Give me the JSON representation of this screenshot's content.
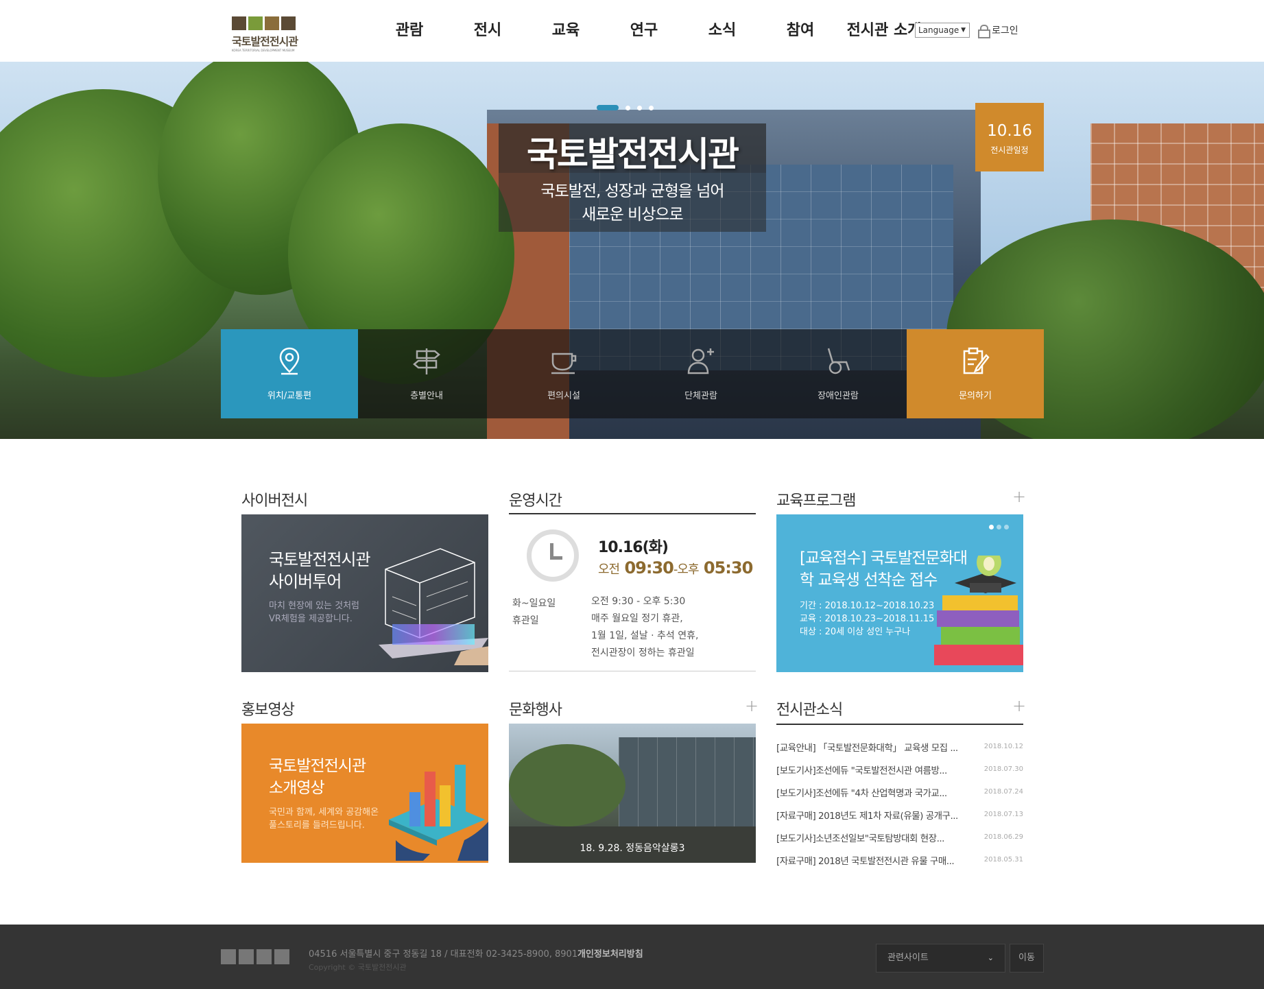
{
  "header": {
    "logo_text": "국토발전전시관",
    "logo_sub": "KOREA TERRITORIAL DEVELOPMENT MUSEUM",
    "nav": [
      "관람",
      "전시",
      "교육",
      "연구",
      "소식",
      "참여",
      "전시관 소개"
    ],
    "language_label": "Language",
    "login_label": "로그인"
  },
  "hero": {
    "title": "국토발전전시관",
    "subtitle_line1": "국토발전, 성장과 균형을 넘어",
    "subtitle_line2": "새로운 비상으로",
    "schedule_date": "10.16",
    "schedule_label": "전시관일정",
    "quick_links": [
      "위치/교통편",
      "층별안내",
      "편의시설",
      "단체관람",
      "장애인관람",
      "문의하기"
    ]
  },
  "sections": {
    "cyber": {
      "title": "사이버전시",
      "card_title_1": "국토발전전시관",
      "card_title_2": "사이버투어",
      "card_sub_1": "마치 현장에 있는 것처럼",
      "card_sub_2": "VR체험을 제공합니다."
    },
    "hours": {
      "title": "운영시간",
      "date": "10.16(화)",
      "am_label": "오전",
      "am_time": "09:30",
      "pm_label": "오후",
      "pm_time": "05:30",
      "row1_label": "화~일요일",
      "row1_value": "오전 9:30 - 오후 5:30",
      "row2_label": "휴관일",
      "row2_value_1": "매주 월요일 정기 휴관,",
      "row2_value_2": "1월 1일, 설날 · 추석 연휴,",
      "row2_value_3": "전시관장이 정하는 휴관일"
    },
    "education": {
      "title": "교육프로그램",
      "card_title": "[교육접수] 국토발전문화대학 교육생 선착순 접수",
      "period": "기간 : 2018.10.12~2018.10.23",
      "class": "교육 : 2018.10.23~2018.11.15",
      "target": "대상 : 20세 이상 성인 누구나"
    },
    "promo": {
      "title": "홍보영상",
      "card_title_1": "국토발전전시관",
      "card_title_2": "소개영상",
      "card_sub_1": "국민과 함께, 세계와 공감해온",
      "card_sub_2": "풀스토리를 들려드립니다."
    },
    "events": {
      "title": "문화행사",
      "caption": "18. 9.28. 정동음악살롱3"
    },
    "news": {
      "title": "전시관소식",
      "items": [
        {
          "title": "[교육안내] 「국토발전문화대학」 교육생 모집 ...",
          "date": "2018.10.12"
        },
        {
          "title": "[보도기사]조선에듀 \"국토발전전시관 여름방...",
          "date": "2018.07.30"
        },
        {
          "title": "[보도기사]조선에듀 \"4차 산업혁명과 국가교...",
          "date": "2018.07.24"
        },
        {
          "title": "[자료구매] 2018년도 제1차 자료(유물) 공개구...",
          "date": "2018.07.13"
        },
        {
          "title": "[보도기사]소년조선일보\"국토탐방대회 현장...",
          "date": "2018.06.29"
        },
        {
          "title": "[자료구매] 2018년 국토발전전시관 유물 구매...",
          "date": "2018.05.31"
        }
      ]
    }
  },
  "footer": {
    "address": "04516 서울특별시 중구 정동길 18 / 대표전화 02-3425-8900, 8901",
    "privacy": "개인정보처리방침",
    "copyright": "Copyright © 국토발전전시관",
    "related_sites": "관련사이트",
    "go": "이동"
  },
  "colors": {
    "accent_blue": "#2b97bd",
    "accent_orange": "#d08a2c",
    "edu_card": "#4fb3d9",
    "promo_card": "#e8892a",
    "time_brown": "#8c6a2f"
  }
}
